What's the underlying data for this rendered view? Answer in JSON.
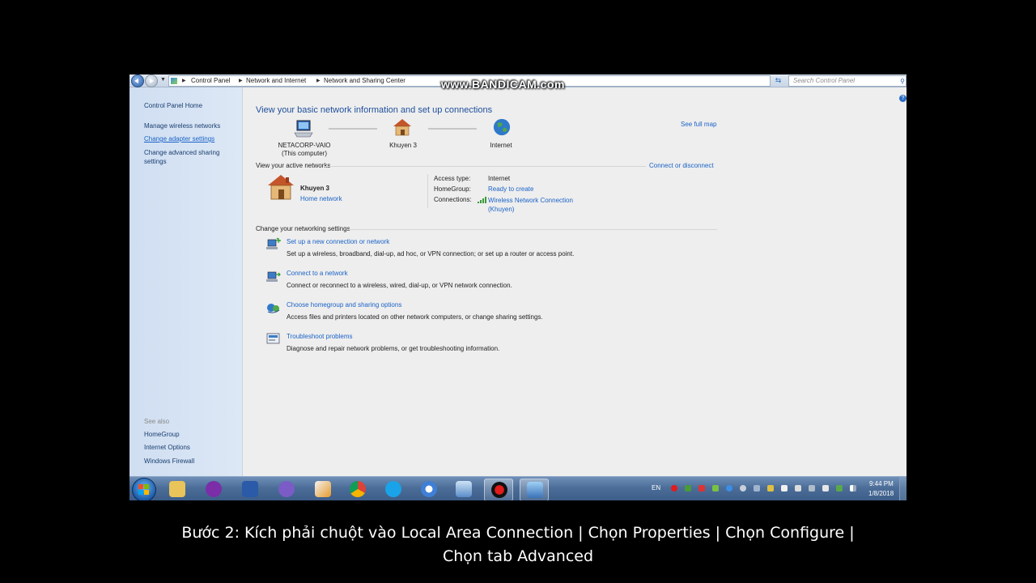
{
  "window": {
    "breadcrumbs": [
      "Control Panel",
      "Network and Internet",
      "Network and Sharing Center"
    ],
    "search_placeholder": "Search Control Panel"
  },
  "watermark": "www.BANDICAM.com",
  "sidebar": {
    "items": [
      {
        "label": "Control Panel Home"
      },
      {
        "label": "Manage wireless networks"
      },
      {
        "label": "Change adapter settings",
        "active": true
      },
      {
        "label": "Change advanced sharing",
        "label2": "settings"
      }
    ],
    "see_also_title": "See also",
    "see_also": [
      "HomeGroup",
      "Internet Options",
      "Windows Firewall"
    ]
  },
  "main": {
    "title": "View your basic network information and set up connections",
    "see_full_map": "See full map",
    "map": {
      "computer_name": "NETACORP-VAIO",
      "computer_sub": "(This computer)",
      "network": "Khuyen  3",
      "internet": "Internet"
    },
    "active_networks_title": "View your active networks",
    "connect_or_disconnect": "Connect or disconnect",
    "active_network": {
      "name": "Khuyen  3",
      "type": "Home network",
      "access_type_label": "Access type:",
      "access_type_value": "Internet",
      "homegroup_label": "HomeGroup:",
      "homegroup_value": "Ready to create",
      "connections_label": "Connections:",
      "connections_value": "Wireless Network Connection",
      "connections_value2": "(Khuyen)"
    },
    "change_settings_title": "Change your networking settings",
    "tasks": [
      {
        "link": "Set up a new connection or network",
        "desc": "Set up a wireless, broadband, dial-up, ad hoc, or VPN connection; or set up a router or access point."
      },
      {
        "link": "Connect to a network",
        "desc": "Connect or reconnect to a wireless, wired, dial-up, or VPN network connection."
      },
      {
        "link": "Choose homegroup and sharing options",
        "desc": "Access files and printers located on other network computers, or change sharing settings."
      },
      {
        "link": "Troubleshoot problems",
        "desc": "Diagnose and repair network problems, or get troubleshooting information."
      }
    ]
  },
  "taskbar": {
    "language": "EN",
    "time": "9:44 PM",
    "date": "1/8/2018"
  },
  "caption": {
    "line1": "Bước 2: Kích phải chuột vào Local Area Connection | Chọn Properties | Chọn Configure |",
    "line2": "Chọn tab Advanced"
  },
  "colors": {
    "link": "#1a62c7",
    "title": "#1e4f9c",
    "taskbar": "#4b6d98"
  }
}
